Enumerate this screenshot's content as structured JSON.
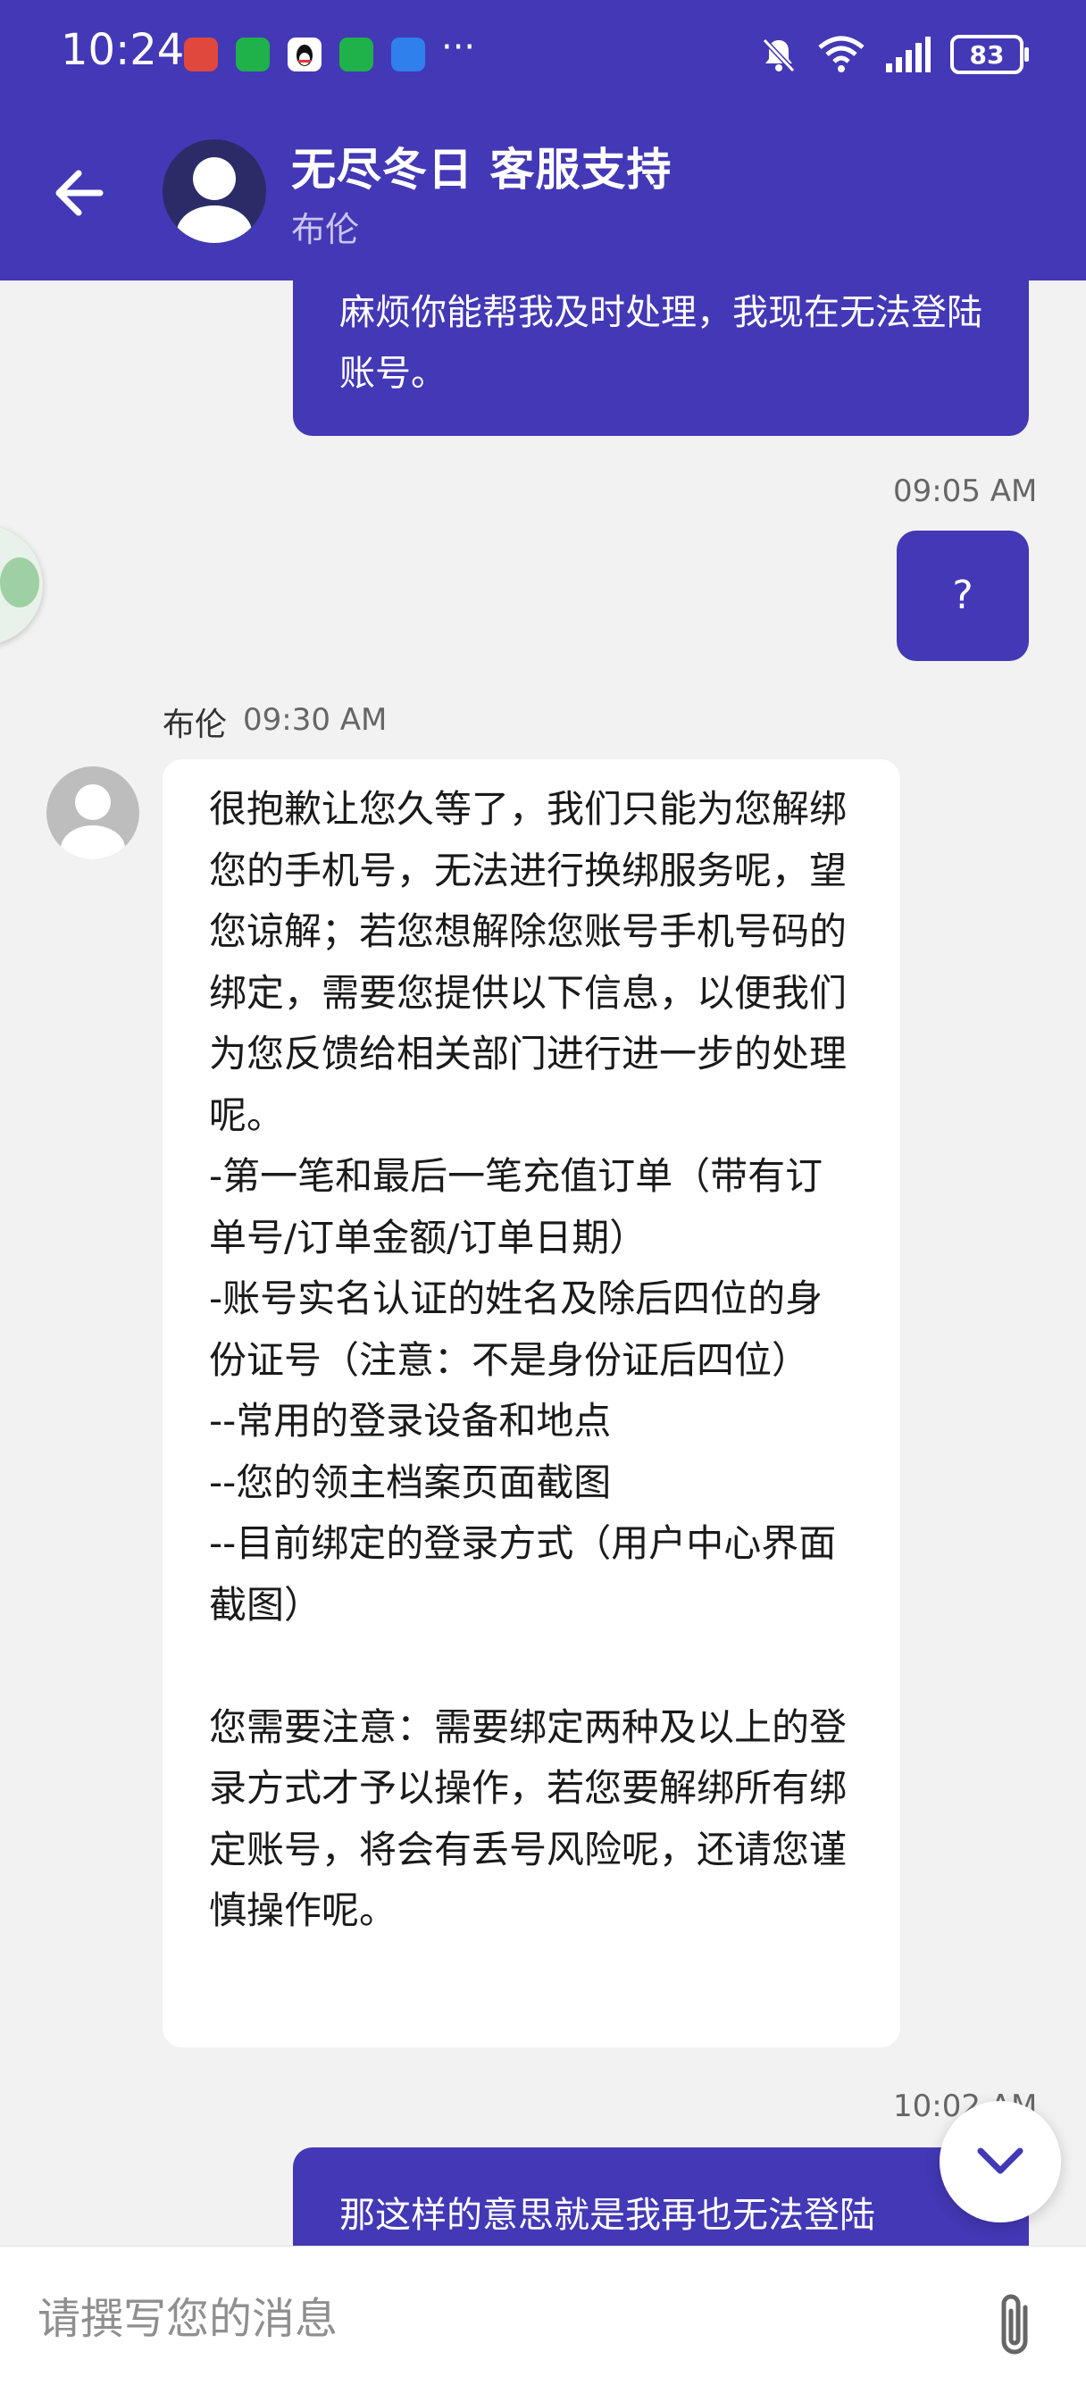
{
  "status_bar": {
    "time": "10:24",
    "more": "···",
    "battery": "83",
    "notification_icons": [
      "red-envelope-icon",
      "wechat-icon",
      "qq-icon",
      "wechat-icon",
      "message-icon"
    ],
    "right_icons": [
      "mute-bell-icon",
      "wifi-icon",
      "signal-icon",
      "battery-icon"
    ]
  },
  "header": {
    "title": "无尽冬日 客服支持",
    "subtitle": "布伦"
  },
  "messages": {
    "out1": {
      "text": "麻烦你能帮我及时处理，我现在无法登陆账号。"
    },
    "out2": {
      "time": "09:05 AM",
      "text": "?"
    },
    "in1": {
      "sender": "布伦",
      "time": "09:30 AM",
      "text": "很抱歉让您久等了，我们只能为您解绑您的手机号，无法进行换绑服务呢，望您谅解；若您想解除您账号手机号码的绑定，需要您提供以下信息，以便我们为您反馈给相关部门进行进一步的处理呢。\n-第一笔和最后一笔充值订单（带有订单号/订单金额/订单日期）\n-账号实名认证的姓名及除后四位的身份证号（注意：不是身份证后四位）\n--常用的登录设备和地点\n--您的领主档案页面截图\n--目前绑定的登录方式（用户中心界面截图）\n\n您需要注意：需要绑定两种及以上的登录方式才予以操作，若您要解绑所有绑定账号，将会有丢号风险呢，还请您谨慎操作呢。"
    },
    "out3": {
      "time": "10:02 AM",
      "text": "那这样的意思就是我再也无法登陆"
    }
  },
  "composer": {
    "placeholder": "请撰写您的消息"
  },
  "colors": {
    "primary": "#4338b5",
    "background": "#f2f2f2"
  }
}
